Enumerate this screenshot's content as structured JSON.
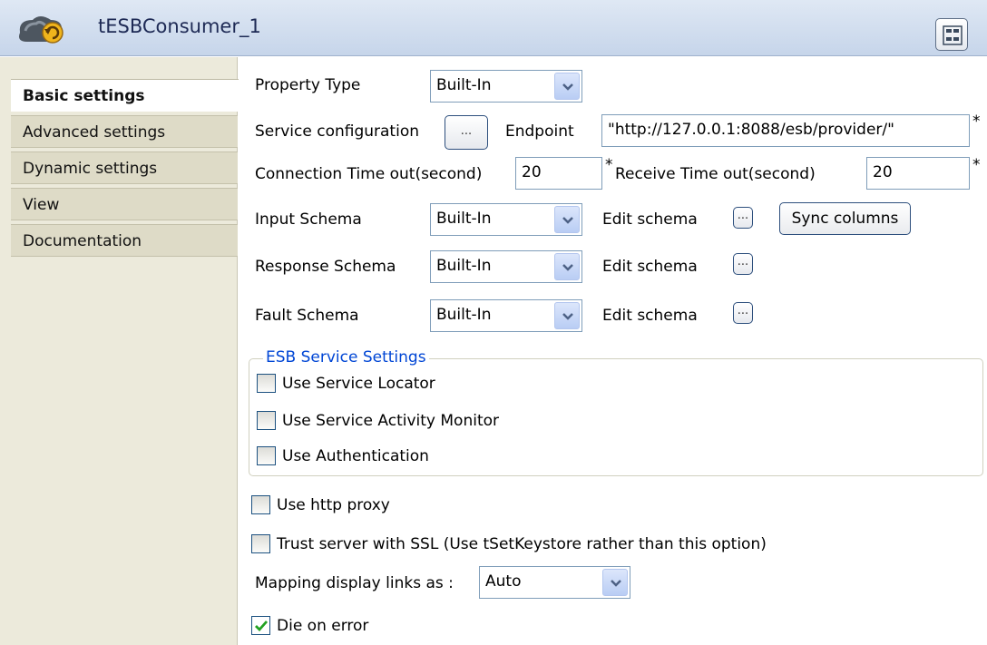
{
  "title": "tESBConsumer_1",
  "tabs": [
    "Basic settings",
    "Advanced settings",
    "Dynamic settings",
    "View",
    "Documentation"
  ],
  "form": {
    "property_type": {
      "label": "Property Type",
      "value": "Built-In"
    },
    "service_configuration": {
      "label": "Service configuration",
      "button": "..."
    },
    "endpoint": {
      "label": "Endpoint",
      "value": "\"http://127.0.0.1:8088/esb/provider/\""
    },
    "connection_timeout": {
      "label": "Connection Time out(second)",
      "value": "20"
    },
    "receive_timeout": {
      "label": "Receive Time out(second)",
      "value": "20"
    },
    "input_schema": {
      "label": "Input Schema",
      "value": "Built-In",
      "edit_label": "Edit schema",
      "button": "..."
    },
    "sync_columns": "Sync columns",
    "response_schema": {
      "label": "Response Schema",
      "value": "Built-In",
      "edit_label": "Edit schema",
      "button": "..."
    },
    "fault_schema": {
      "label": "Fault Schema",
      "value": "Built-In",
      "edit_label": "Edit schema",
      "button": "..."
    },
    "required_marker": "*"
  },
  "esb_group": {
    "legend": "ESB Service Settings",
    "use_service_locator": {
      "label": "Use Service Locator",
      "checked": false
    },
    "use_activity_monitor": {
      "label": "Use Service Activity Monitor",
      "checked": false
    },
    "use_authentication": {
      "label": "Use Authentication",
      "checked": false
    }
  },
  "use_http_proxy": {
    "label": "Use http proxy",
    "checked": false
  },
  "trust_ssl": {
    "label": "Trust server with SSL (Use tSetKeystore rather than this option)",
    "checked": false
  },
  "mapping": {
    "label": "Mapping display links as :",
    "value": "Auto"
  },
  "die_on_error": {
    "label": "Die on error",
    "checked": true
  },
  "icons": {
    "component": "esb-consumer-icon",
    "layout": "layout-grid-icon",
    "dropdown": "chevron-down-icon",
    "check": "checkmark-icon"
  },
  "colors": {
    "title_bg": "#c6d5ea",
    "sidebar_bg": "#eceadb",
    "group_legend": "#0046d5",
    "combo_arrow": "#b9cdf4"
  }
}
